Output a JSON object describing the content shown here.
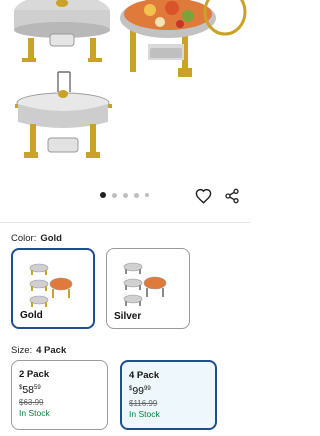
{
  "gallery": {
    "dots": 5,
    "active_dot": 0,
    "icons": [
      "chafing-dish-image",
      "heart-icon",
      "share-icon"
    ]
  },
  "color": {
    "label": "Color:",
    "selected": "Gold",
    "options": [
      {
        "name": "Gold",
        "selected": true
      },
      {
        "name": "Silver",
        "selected": false
      }
    ]
  },
  "size": {
    "label": "Size:",
    "selected": "4 Pack",
    "options": [
      {
        "title": "2 Pack",
        "currency": "$",
        "price_whole": "58",
        "price_cents": "59",
        "was": "$63.99",
        "stock": "In Stock",
        "selected": false
      },
      {
        "title": "4 Pack",
        "currency": "$",
        "price_whole": "99",
        "price_cents": "99",
        "was": "$116.99",
        "stock": "In Stock",
        "selected": true
      }
    ]
  },
  "colors": {
    "selected_border": "#1f4f8a",
    "in_stock": "#067d3c",
    "gold": "#c9a227"
  }
}
